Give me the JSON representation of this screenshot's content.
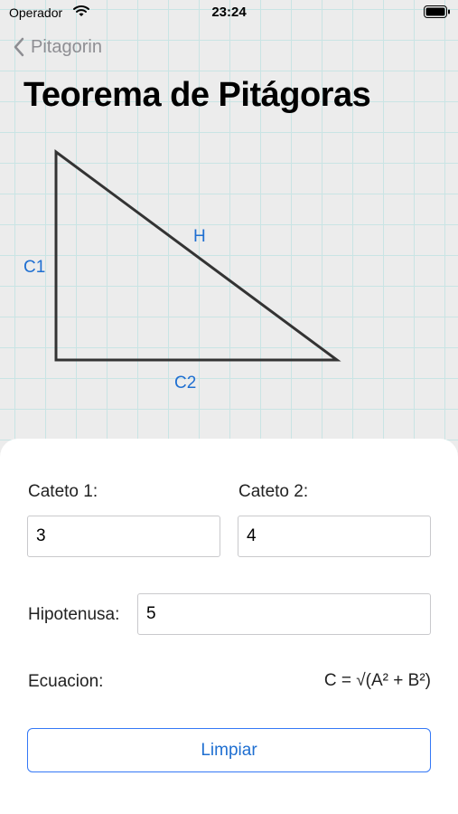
{
  "status_bar": {
    "carrier": "Operador",
    "time": "23:24"
  },
  "nav": {
    "back_label": "Pitagorin"
  },
  "page": {
    "title": "Teorema de Pitágoras"
  },
  "diagram": {
    "label_c1": "C1",
    "label_h": "H",
    "label_c2": "C2"
  },
  "form": {
    "cateto1_label": "Cateto 1:",
    "cateto1_value": "3",
    "cateto2_label": "Cateto 2:",
    "cateto2_value": "4",
    "hipotenusa_label": "Hipotenusa:",
    "hipotenusa_value": "5",
    "ecuacion_label": "Ecuacion:",
    "ecuacion_formula": "C = √(A² + B²)",
    "clear_label": "Limpiar"
  },
  "colors": {
    "accent": "#1f6fd1",
    "grid_line": "#c9e4e4",
    "background": "#ececec",
    "triangle_stroke": "#333333"
  }
}
